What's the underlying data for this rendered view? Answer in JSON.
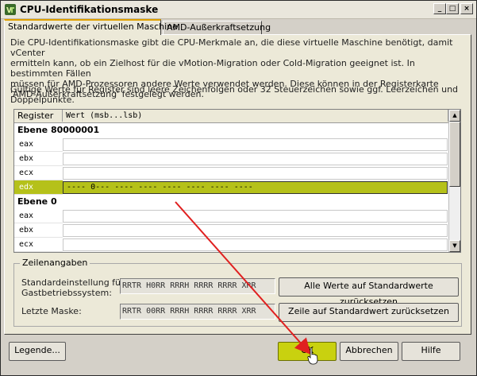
{
  "window": {
    "title": "CPU-Identifikationsmaske",
    "controls": {
      "minimize": "_",
      "maximize": "□",
      "close": "×"
    }
  },
  "tabs": [
    {
      "label": "Standardwerte der virtuellen Maschine",
      "active": true
    },
    {
      "label": "AMD-Außerkraftsetzung",
      "active": false
    }
  ],
  "description": "Die CPU-Identifikationsmaske gibt die CPU-Merkmale an, die diese virtuelle Maschine benötigt, damit vCenter\nermitteln kann, ob ein Zielhost für die vMotion-Migration oder Cold-Migration geeignet ist. In bestimmten Fällen\nmüssen für AMD-Prozessoren andere Werte verwendet werden. Diese können in der Registerkarte\n'AMD-Außerkraftsetzung' festgelegt werden.",
  "hint": "Gültige Werte für Register sind leere Zeichenfolgen oder 32 Steuerzeichen sowie ggf. Leerzeichen und\nDoppelpunkte.",
  "grid": {
    "headers": {
      "register": "Register",
      "value": "Wert (msb...lsb)"
    },
    "sections": [
      {
        "title": "Ebene 80000001",
        "rows": [
          {
            "register": "eax",
            "value": "",
            "selected": false
          },
          {
            "register": "ebx",
            "value": "",
            "selected": false
          },
          {
            "register": "ecx",
            "value": "",
            "selected": false
          },
          {
            "register": "edx",
            "value": "---- 0--- ---- ---- ---- ---- ---- ----",
            "selected": true
          }
        ]
      },
      {
        "title": "Ebene 0",
        "rows": [
          {
            "register": "eax",
            "value": "",
            "selected": false
          },
          {
            "register": "ebx",
            "value": "",
            "selected": false
          },
          {
            "register": "ecx",
            "value": "",
            "selected": false
          }
        ]
      }
    ]
  },
  "row_details": {
    "legend": "Zeilenangaben",
    "default_label": "Standardeinstellung für\nGastbetriebssystem:",
    "default_mask": "RRTR H0RR RRRH RRRR RRRR XRR",
    "last_label": "Letzte Maske:",
    "last_mask": "RRTR 00RR RRRH RRRR RRRR XRR",
    "reset_all_label": "Alle Werte auf Standardwerte zurücksetzen",
    "reset_row_label": "Zeile auf Standardwert zurücksetzen"
  },
  "footer": {
    "legend_button": "Legende...",
    "ok_button": "OK",
    "cancel_button": "Abbrechen",
    "help_button": "Hilfe"
  },
  "colors": {
    "selection": "#b5c11a",
    "ok_button": "#c9d10f",
    "annotation_arrow": "#e02020",
    "tab_highlight": "#e0a000"
  }
}
